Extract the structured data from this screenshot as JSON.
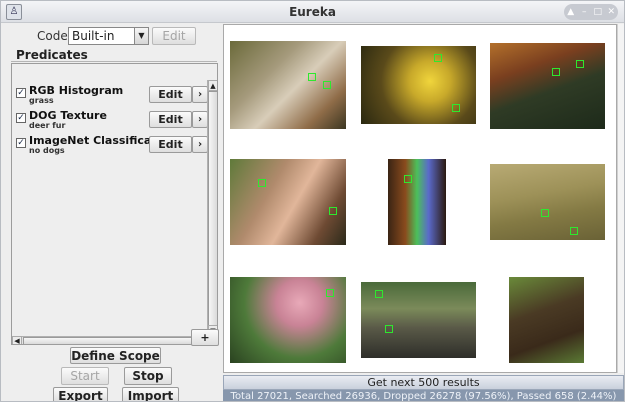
{
  "window": {
    "title": "Eureka"
  },
  "codec": {
    "label": "Codec",
    "value": "Built-in",
    "edit_label": "Edit"
  },
  "predicates": {
    "title": "Predicates",
    "items": [
      {
        "name": "RGB Histogram",
        "desc": "grass",
        "checked": true,
        "edit_label": "Edit",
        "more_label": "›"
      },
      {
        "name": "DOG Texture",
        "desc": "deer fur",
        "checked": true,
        "edit_label": "Edit",
        "more_label": "›"
      },
      {
        "name": "ImageNet Classification",
        "desc": "no dogs",
        "checked": true,
        "edit_label": "Edit",
        "more_label": "›"
      }
    ],
    "add_label": "+"
  },
  "actions": {
    "define_scope": "Define Scope",
    "start": "Start",
    "stop": "Stop",
    "export": "Export",
    "import": "Import"
  },
  "results": {
    "get_next": "Get next 500 results",
    "status": "Total 27021, Searched 26936, Dropped 26278 (97.56%), Passed 658 (2.44%)"
  },
  "colors": {
    "match_patch": "#2ee82e",
    "status_bar": "#8797ad"
  }
}
